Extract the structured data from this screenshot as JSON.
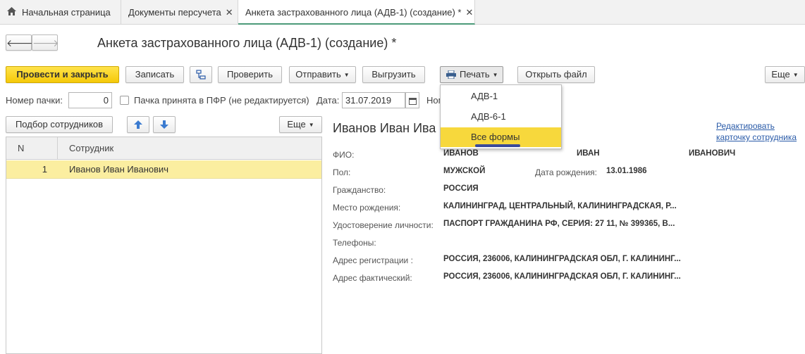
{
  "tabs": [
    {
      "label": "Начальная страница",
      "closable": false
    },
    {
      "label": "Документы персучета",
      "closable": true
    },
    {
      "label": "Анкета застрахованного лица (АДВ-1) (создание) *",
      "closable": true
    }
  ],
  "tab_close_glyph": "✕",
  "nav": {
    "back": "🡐",
    "forward": "🡒"
  },
  "page_title": "Анкета застрахованного лица (АДВ-1) (создание) *",
  "toolbar": {
    "post_close": "Провести и закрыть",
    "save": "Записать",
    "check": "Проверить",
    "send": "Отправить",
    "export": "Выгрузить",
    "print": "Печать",
    "open_file": "Открыть файл",
    "more": "Еще"
  },
  "form": {
    "batch_label": "Номер пачки:",
    "batch_value": "0",
    "accepted_label": "Пачка принята в ПФР (не редактируется)",
    "date_label": "Дата:",
    "date_value": "31.07.2019",
    "number_label_partial": "Ном"
  },
  "list_toolbar": {
    "select_employees": "Подбор сотрудников",
    "more": "Еще"
  },
  "table": {
    "columns": [
      "N",
      "Сотрудник"
    ],
    "rows": [
      {
        "n": "1",
        "employee": "Иванов Иван Иванович"
      }
    ]
  },
  "employee_card": {
    "name_visible": "Иванов Иван Ива",
    "edit_link_line1": "Редактировать",
    "edit_link_line2": "карточку сотрудника",
    "fio_label": "ФИО:",
    "last_name": "ИВАНОВ",
    "first_name": "ИВАН",
    "patronymic": "ИВАНОВИЧ",
    "sex_label": "Пол:",
    "sex": "МУЖСКОЙ",
    "birth_date_label": "Дата рождения:",
    "birth_date": "13.01.1986",
    "citizenship_label": "Гражданство:",
    "citizenship": "РОССИЯ",
    "birth_place_label": "Место рождения:",
    "birth_place": "КАЛИНИНГРАД, ЦЕНТРАЛЬНЫЙ, КАЛИНИНГРАДСКАЯ, Р...",
    "id_doc_label": "Удостоверение личности:",
    "id_doc": "ПАСПОРТ ГРАЖДАНИНА РФ, СЕРИЯ: 27 11, № 399365, В...",
    "phones_label": "Телефоны:",
    "phones": "",
    "reg_address_label": "Адрес регистрации :",
    "reg_address": "РОССИЯ, 236006, КАЛИНИНГРАДСКАЯ ОБЛ, Г. КАЛИНИНГ...",
    "actual_address_label": "Адрес фактический:",
    "actual_address": "РОССИЯ, 236006, КАЛИНИНГРАДСКАЯ ОБЛ, Г. КАЛИНИНГ..."
  },
  "print_menu": {
    "items": [
      "АДВ-1",
      "АДВ-6-1",
      "Все формы"
    ],
    "selected": "Все формы"
  },
  "colors": {
    "accent_yellow": "#f5c909",
    "row_highlight": "#fbeea0",
    "link": "#2a5ba8",
    "active_tab_line": "#4c9a79"
  }
}
